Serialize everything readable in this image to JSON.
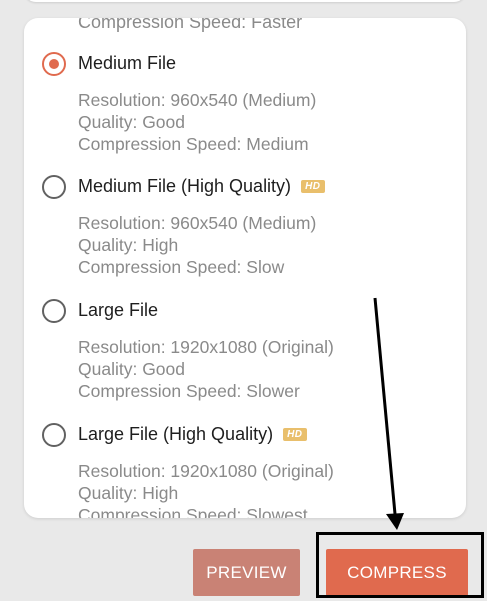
{
  "previous_option": {
    "speed_line": "Compression Speed: Faster"
  },
  "options": [
    {
      "title": "Medium File",
      "selected": true,
      "hd": false,
      "resolution": "Resolution: 960x540 (Medium)",
      "quality": "Quality: Good",
      "speed": "Compression Speed: Medium"
    },
    {
      "title": "Medium File (High Quality)",
      "selected": false,
      "hd": true,
      "hd_label": "HD",
      "resolution": "Resolution: 960x540 (Medium)",
      "quality": "Quality: High",
      "speed": "Compression Speed: Slow"
    },
    {
      "title": "Large File",
      "selected": false,
      "hd": false,
      "resolution": "Resolution: 1920x1080 (Original)",
      "quality": "Quality: Good",
      "speed": "Compression Speed: Slower"
    },
    {
      "title": "Large File (High Quality)",
      "selected": false,
      "hd": true,
      "hd_label": "HD",
      "resolution": "Resolution: 1920x1080 (Original)",
      "quality": "Quality: High",
      "speed": "Compression Speed: Slowest"
    }
  ],
  "buttons": {
    "preview": "PREVIEW",
    "compress": "COMPRESS"
  },
  "colors": {
    "accent": "#e06a4e",
    "preview_button": "#c98275",
    "hd_badge": "#e9bf6c",
    "annotation": "#000000"
  },
  "icons": {
    "radio_on": "radio-checked-icon",
    "radio_off": "radio-unchecked-icon",
    "hd": "hd-badge-icon",
    "annotation": "arrow-annotation"
  }
}
